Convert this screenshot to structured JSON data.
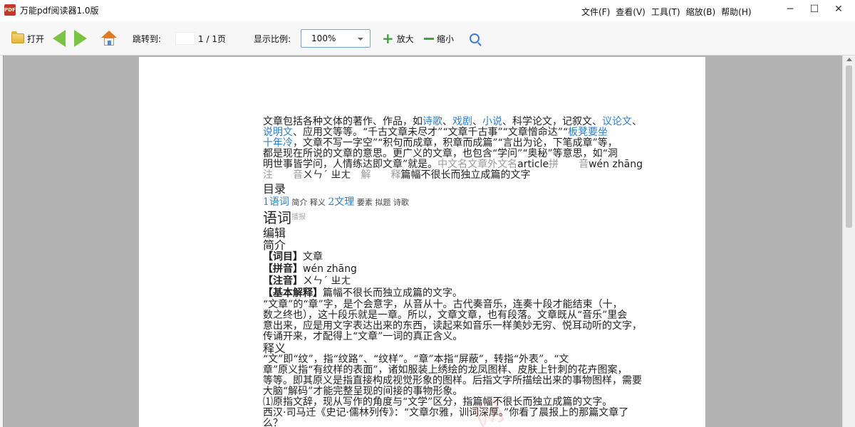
{
  "app": {
    "icon_text": "PDF",
    "title": "万能pdf阅读器1.0版"
  },
  "menus": [
    "文件(F)",
    "查看(V)",
    "工具(T)",
    "缩放(B)",
    "帮助(H)"
  ],
  "window_controls": {
    "min": "─",
    "max": "☐",
    "close": "✕"
  },
  "toolbar": {
    "open_label": "打开",
    "jump_label": "跳转到:",
    "page_indicator": "1 / 1页",
    "zoom_label": "显示比例:",
    "zoom_value": "100%",
    "zoom_in_label": "放大",
    "zoom_out_label": "缩小"
  },
  "doc": {
    "intro_l1_a": "文章包括各种文体的著作、作品，如",
    "intro_l1_lnk1": "诗歌",
    "intro_l1_b": "、",
    "intro_l1_lnk2": "戏剧",
    "intro_l1_c": "、",
    "intro_l1_lnk3": "小说",
    "intro_l1_d": "、科学论文，记叙文、",
    "intro_l1_lnk4": "议论文",
    "intro_l1_e": "、",
    "intro_l2_lnk1": "说明文",
    "intro_l2_a": "、应用文等等。“千古文章未尽才”“文章千古事”“文章憎命达”“",
    "intro_l2_lnk2": "板凳要坐",
    "intro_l3_lnk1": "十年冷",
    "intro_l3_a": "，文章不写一字空”“积句而成章，积章而成篇”“言出为论，下笔成章”等，",
    "intro_l4": "都是现在所说的文章的意思。更广义的文章，也包含“学问”“奥秘”等意思，如“洞",
    "intro_l5_a": "明世事皆学问，人情练达即文章”就是。",
    "intro_l5_gray": "中文名文章外文名",
    "intro_l5_b": "article",
    "intro_l5_gray2": "拼　　音",
    "intro_l5_c": "wén zhāng",
    "intro_l6_gray": "注　　音",
    "intro_l6_a": "ㄨㄣˊ ㄓㄤ",
    "intro_l6_gray2": "解　　释",
    "intro_l6_b": "篇幅不很长而独立成篇的文字",
    "toc_title": "目录",
    "toc_1": "1语词",
    "toc_1a": "简介",
    "toc_1b": "释义",
    "toc_2": "2文理",
    "toc_2a": "要素",
    "toc_2b": "拟题",
    "toc_2c": "诗歌",
    "section_title": "语词",
    "section_sub": "播报",
    "edit": "编辑",
    "intro_head": "简介",
    "f1_k": "【词目】",
    "f1_v": "文章",
    "f2_k": "【拼音】",
    "f2_v": "wén zhāng",
    "f3_k": "【注音】",
    "f3_v": "ㄨㄣˊ ㄓㄤ",
    "f4_k": "【基本解释】",
    "f4_v": "篇幅不很长而独立成篇的文字。",
    "para1_l1": "“文章”的“章”字，是个会意字，从音从十。古代奏音乐，连奏十段才能结束（十，",
    "para1_l2": "数之终也），这十段乐就是一章。所以，文章文章，也有段落。文章既从“音乐”里会",
    "para1_l3": "意出来，应是用文字表达出来的东西，读起来如音乐一样美妙无穷、悦耳动听的文字，",
    "para1_l4": "传诵开来，才配得上“文章”一词的真正含义。",
    "shiyi": "释义",
    "para2_l1": "“文”即“纹”，指“纹路”、“纹样”。“章”本指“屏蔽”，转指“外表”。“文",
    "para2_l2": "章”原义指“有纹样的表面”，诸如服装上绣绘的龙凤图样、皮肤上针刺的花卉图案，",
    "para2_l3": "等等。即其原义是指直接构成视觉形象的图样。后指文字所描绘出来的事物图样，需要",
    "para2_l4": "大脑“解码”才能完整呈现的间接的事物形象。",
    "para3": "⑴原指文辞，现从写作的角度与“文学”区分，指篇幅不很长而独立成篇的文字。",
    "para4": "西汉·司马迁《史记·儒林列传》：“文章尔雅，训词深厚。”你看了晨报上的那篇文章了",
    "para5": "么？",
    "watermark": "网"
  }
}
